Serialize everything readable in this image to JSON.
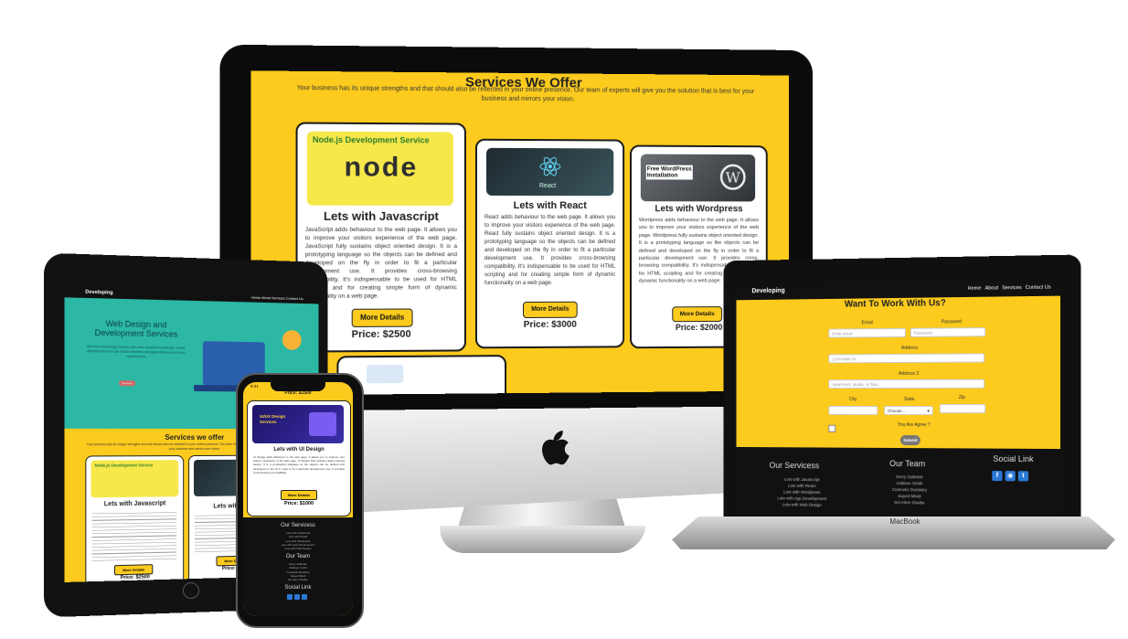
{
  "imac": {
    "heading": "Services We Offer",
    "intro": "Your business has its unique strengths and that should also be reflected in your online presence. Our team of experts will give you the solution that is best for your business and mirrors your vision.",
    "cards": [
      {
        "title": "Lets with Javascript",
        "thumb_caption": "Node.js Development Service",
        "thumb_logo": "node",
        "desc": "JavaScript adds behaviour to the web page. It allows you to improve your visitors experience of the web page. JavaScript fully sustains object oriented design. It is a prototyping language so the objects can be defined and developed on the fly in order to fit a particular development use. It provides cross-browsing compatibility. It's indispensable to be used for HTML scripting and for creating simple form of dynamic functionality on a web page.",
        "button": "More Details",
        "price": "Price: $2500"
      },
      {
        "title": "Lets with React",
        "thumb_caption": "React",
        "desc": "React adds behaviour to the web page. It allows you to improve your visitors experience of the web page. React fully sustains object oriented design. It is a prototyping language so the objects can be defined and developed on the fly in order to fit a particular development use. It provides cross-browsing compatibility. It's indispensable to be used for HTML scripting and for creating simple form of dynamic functionality on a web page.",
        "button": "More Details",
        "price": "Price: $3000"
      },
      {
        "title": "Lets with Wordpress",
        "thumb_caption": "Free WordPress Installation",
        "desc": "Wordpress adds behaviour to the web page. It allows you to improve your visitors experience of the web page. Wordpress fully sustains object oriented design. It is a prototyping language so the objects can be defined and developed on the fly in order to fit a particular development use. It provides cross-browsing compatibility. It's indispensable to be used for HTML scripting and for creating simple form of dynamic functionality on a web page.",
        "button": "More Details",
        "price": "Price: $2000"
      }
    ]
  },
  "laptop": {
    "brand": "Developing",
    "nav": [
      "Home",
      "About",
      "Services",
      "Contact Us"
    ],
    "label": "MacBook",
    "form": {
      "title": "Want To Work With Us?",
      "email_label": "Email",
      "email_placeholder": "Enter email",
      "password_label": "Password",
      "password_placeholder": "Password",
      "address_label": "Address",
      "address_placeholder": "1234 Main St",
      "address2_label": "Address 2",
      "address2_placeholder": "Apartment, studio, or floor",
      "city_label": "City",
      "state_label": "State",
      "state_value": "Choose...",
      "zip_label": "Zip",
      "agree_label": "You Are Agree ?",
      "submit": "Submit"
    },
    "footer": {
      "services_title": "Our Servicess",
      "services": [
        "Lets with Javascript",
        "Lets with React",
        "Lets with Wordpress",
        "Lets with App Development",
        "Lets with Web Design"
      ],
      "team_title": "Our Team",
      "team": [
        "Gerry Gabriele",
        "Addison Smith",
        "Cosmetic Dentistry",
        "Sayed Mirali",
        "Sei Alem Shaibe"
      ],
      "social_title": "Social Link",
      "social_icons": [
        "facebook-icon",
        "instagram-icon",
        "twitter-icon"
      ]
    }
  },
  "tablet": {
    "brand": "Developing",
    "nav": "Home About Services Contact Us",
    "hero_title": "Web Design and Development Services",
    "hero_text": "We have technology experts who have excellent knowledge of web development and can create websites and applications as per your requirements.",
    "hero_button": "Services",
    "services_heading": "Services we offer",
    "services_intro": "Your business has its unique strengths and that should also be reflected in your online presence. Our team of experts will give you the solution that is best for your business and mirrors your vision.",
    "card1_caption": "Node.js Development Service",
    "card1_title": "Lets with Javascript",
    "card1_button": "More Details",
    "card1_price": "Price: $2500",
    "card2_title": "Lets with React",
    "card2_button": "More Details",
    "card2_price": "Price: $3000"
  },
  "phone": {
    "time": "9:41",
    "prev_price": "Price: $1500",
    "card_image_text": "UI/UX Design Services",
    "card_title": "Lets with UI Design",
    "card_desc": "UI Design adds behaviour to the web page. It allows you to improve your visitors experience of the web page. UI Design fully sustains object oriented design. It is a prototyping language so the objects can be defined and developed on the fly in order to fit a particular development use. It provides cross-browsing compatibility.",
    "card_button": "More Details",
    "card_price": "Price: $1000",
    "footer_services_title": "Our Servicess",
    "footer_services": [
      "Lets with Javascript",
      "Lets with React",
      "Lets with Wordpress",
      "Lets with App Development",
      "Lets with Web Design"
    ],
    "footer_team_title": "Our Team",
    "footer_team": [
      "Gerry Gabriele",
      "Addison Smith",
      "Cosmetic Dentistry",
      "Sayed Mirali",
      "Sei Alem Shaibe"
    ],
    "footer_social_title": "Social Link"
  },
  "colors": {
    "brand_yellow": "#fccb1e",
    "dark": "#111111",
    "teal_hero": "#2cb8a5",
    "social_blue": "#2b79d5"
  }
}
